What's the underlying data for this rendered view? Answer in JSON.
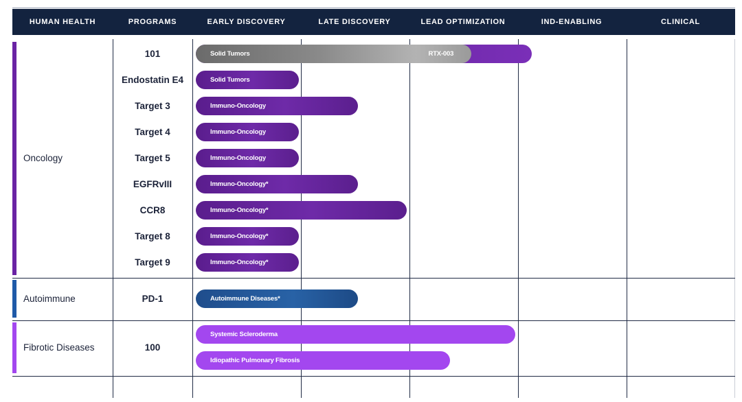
{
  "header": {
    "columns": [
      "HUMAN HEALTH",
      "PROGRAMS",
      "EARLY DISCOVERY",
      "LATE DISCOVERY",
      "LEAD OPTIMIZATION",
      "IND-ENABLING",
      "CLINICAL"
    ],
    "background": "#13233f"
  },
  "colors": {
    "oncology": "#5b1f8e",
    "oncology_light": "#7a2fb8",
    "autoimmune": "#1f4f8f",
    "fibrotic": "#a347ef",
    "gray_segment": "#6f6f6f"
  },
  "chart_data": {
    "type": "bar",
    "stages": [
      "EARLY DISCOVERY",
      "LATE DISCOVERY",
      "LEAD OPTIMIZATION",
      "IND-ENABLING",
      "CLINICAL"
    ],
    "areas": [
      {
        "name": "Oncology",
        "programs": [
          {
            "program": "101",
            "bars": [
              {
                "label": "Solid Tumors",
                "second_label": "RTX-003",
                "stage_progress": 3.1
              }
            ]
          },
          {
            "program": "Endostatin E4",
            "bars": [
              {
                "label": "Solid Tumors",
                "stage_progress": 0.95
              }
            ]
          },
          {
            "program": "Target 3",
            "bars": [
              {
                "label": "Immuno-Oncology",
                "stage_progress": 1.5
              }
            ]
          },
          {
            "program": "Target 4",
            "bars": [
              {
                "label": "Immuno-Oncology",
                "stage_progress": 0.95
              }
            ]
          },
          {
            "program": "Target 5",
            "bars": [
              {
                "label": "Immuno-Oncology",
                "stage_progress": 0.95
              }
            ]
          },
          {
            "program": "EGFRvIII",
            "bars": [
              {
                "label": "Immuno-Oncology*",
                "stage_progress": 1.5
              }
            ]
          },
          {
            "program": "CCR8",
            "bars": [
              {
                "label": "Immuno-Oncology*",
                "stage_progress": 1.95
              }
            ]
          },
          {
            "program": "Target 8",
            "bars": [
              {
                "label": "Immuno-Oncology*",
                "stage_progress": 0.95
              }
            ]
          },
          {
            "program": "Target 9",
            "bars": [
              {
                "label": "Immuno-Oncology*",
                "stage_progress": 0.95
              }
            ]
          }
        ]
      },
      {
        "name": "Autoimmune",
        "programs": [
          {
            "program": "PD-1",
            "bars": [
              {
                "label": "Autoimmune Diseases*",
                "stage_progress": 1.5
              }
            ]
          }
        ]
      },
      {
        "name": "Fibrotic Diseases",
        "programs": [
          {
            "program": "100",
            "bars": [
              {
                "label": "Systemic Scleroderma",
                "stage_progress": 2.95
              },
              {
                "label": "Idiopathic Pulmonary Fibrosis",
                "stage_progress": 2.35
              }
            ]
          }
        ]
      }
    ]
  }
}
